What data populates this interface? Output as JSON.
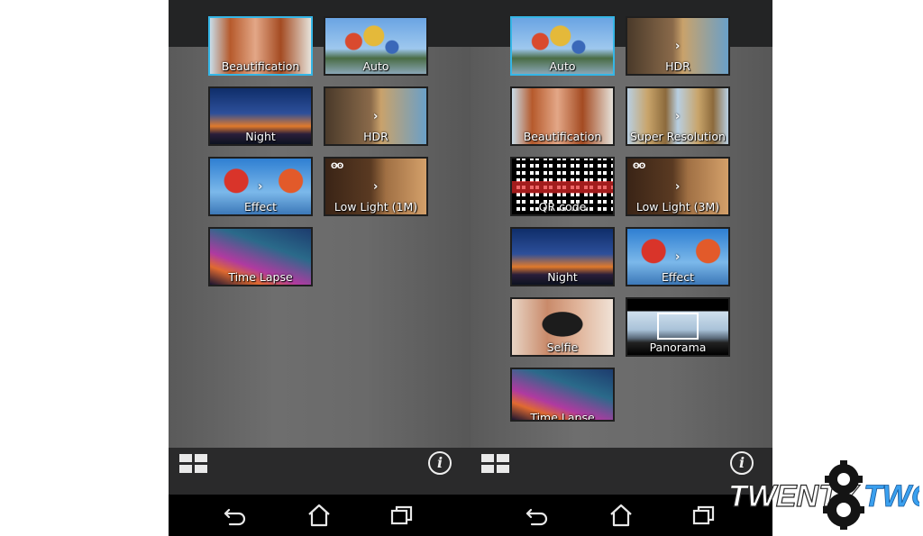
{
  "left_phone": {
    "modes": [
      {
        "label": "Beautification",
        "selected": true
      },
      {
        "label": "Auto"
      },
      {
        "label": "Night"
      },
      {
        "label": "HDR"
      },
      {
        "label": "Effect"
      },
      {
        "label": "Low Light (1M)"
      },
      {
        "label": "Time Lapse"
      }
    ]
  },
  "right_phone": {
    "modes": [
      {
        "label": "Auto",
        "selected": true
      },
      {
        "label": "HDR"
      },
      {
        "label": "Beautification"
      },
      {
        "label": "Super Resolution"
      },
      {
        "label": "QR code"
      },
      {
        "label": "Low Light (3M)"
      },
      {
        "label": "Night"
      },
      {
        "label": "Effect"
      },
      {
        "label": "Selfie"
      },
      {
        "label": "Panorama"
      },
      {
        "label": "Time Lapse"
      }
    ]
  },
  "icons": {
    "grid": "grid-view-icon",
    "info": "info-icon",
    "back": "back-icon",
    "home": "home-icon",
    "recents": "recent-apps-icon",
    "arrow": "›",
    "info_glyph": "i"
  },
  "colors": {
    "selected_border": "#35b6e6",
    "top_band": "#232425",
    "bottom_bar": "#2a2a2b",
    "nav_bar": "#000000"
  },
  "logo": {
    "text_left": "TWENTY",
    "text_right": "TWO"
  }
}
